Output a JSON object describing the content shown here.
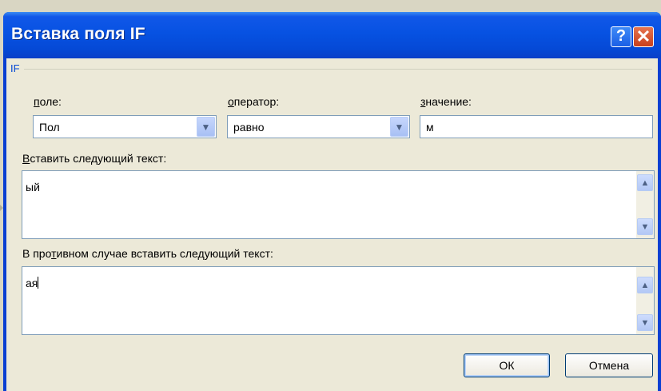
{
  "window": {
    "title": "Вставка поля IF",
    "help_label": "?",
    "close_label": "✕"
  },
  "group": {
    "label": "IF"
  },
  "field": {
    "label_u": "п",
    "label_rest": "оле:",
    "value": "Пол"
  },
  "operator": {
    "label_u": "о",
    "label_rest": "ператор:",
    "value": "равно"
  },
  "compare": {
    "label_u": "з",
    "label_rest": "начение:",
    "value": "м"
  },
  "insert_text": {
    "label_u": "В",
    "label_rest": "ставить следующий текст:",
    "value": "ый"
  },
  "otherwise_text": {
    "label_pre": "В про",
    "label_u": "т",
    "label_rest": "ивном случае вставить следующий текст:",
    "value": "ая"
  },
  "buttons": {
    "ok": "ОК",
    "cancel": "Отмена"
  },
  "icons": {
    "dropdown": "chevron-down-icon",
    "scroll_up": "scroll-up-icon",
    "scroll_down": "scroll-down-icon"
  }
}
